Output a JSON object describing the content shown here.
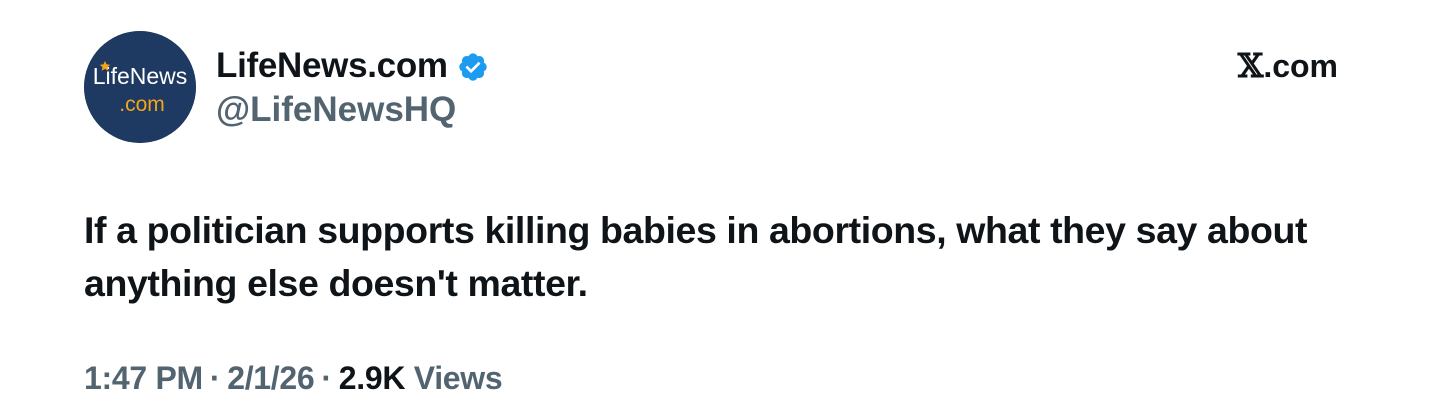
{
  "author": {
    "display_name": "LifeNews.com",
    "handle": "@LifeNewsHQ",
    "verified": true,
    "avatar": {
      "line1": "LifeNews",
      "line2": ".com",
      "background": "#1e3a63",
      "accent": "#f2a51a"
    }
  },
  "source": {
    "glyph": "𝕏",
    "suffix": ".com"
  },
  "tweet": {
    "text": "If a politician supports killing babies in abortions, what they say about anything else doesn't matter."
  },
  "meta": {
    "time": "1:47 PM",
    "separator": "·",
    "date": "2/1/26",
    "views_count": "2.9K",
    "views_label": "Views"
  },
  "colors": {
    "primary_text": "#0f1419",
    "secondary_text": "#536471",
    "verified_blue": "#1d9bf0"
  }
}
